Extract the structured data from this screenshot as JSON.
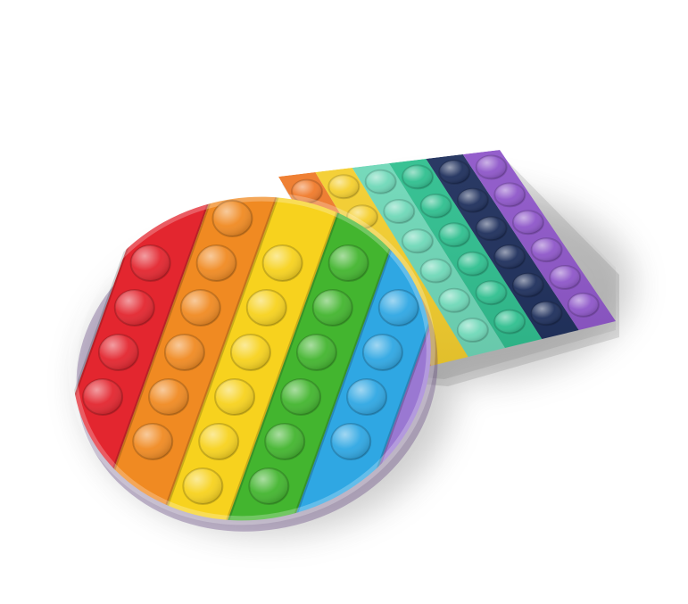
{
  "scene": {
    "background": "#ffffff",
    "objects": [
      {
        "kind": "square-push-pop-toy",
        "columns": 6,
        "rows": 6,
        "colors": [
          "#f07a2a",
          "#f5cf2e",
          "#6fd8b8",
          "#2fbf8f",
          "#1e2f5c",
          "#8e56c9"
        ]
      },
      {
        "kind": "round-push-pop-toy",
        "stripes": 6,
        "colors": [
          "#e3262f",
          "#f08a22",
          "#f7d21e",
          "#43b52f",
          "#2fa7e3",
          "#9a78d2"
        ]
      }
    ]
  }
}
